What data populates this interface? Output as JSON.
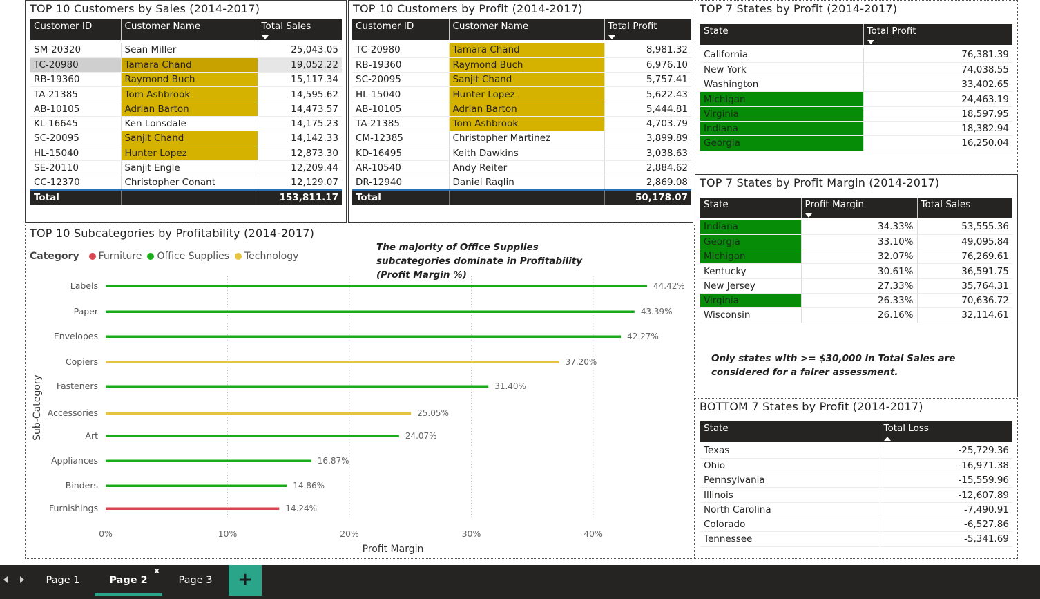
{
  "customers_sales": {
    "title": "TOP 10 Customers by Sales (2014-2017)",
    "headers": [
      "Customer ID",
      "Customer Name",
      "Total Sales"
    ],
    "rows": [
      [
        "SM-20320",
        "Sean Miller",
        "25,043.05"
      ],
      [
        "TC-20980",
        "Tamara Chand",
        "19,052.22"
      ],
      [
        "RB-19360",
        "Raymond Buch",
        "15,117.34"
      ],
      [
        "TA-21385",
        "Tom Ashbrook",
        "14,595.62"
      ],
      [
        "AB-10105",
        "Adrian Barton",
        "14,473.57"
      ],
      [
        "KL-16645",
        "Ken Lonsdale",
        "14,175.23"
      ],
      [
        "SC-20095",
        "Sanjit Chand",
        "14,142.33"
      ],
      [
        "HL-15040",
        "Hunter Lopez",
        "12,873.30"
      ],
      [
        "SE-20110",
        "Sanjit Engle",
        "12,209.44"
      ],
      [
        "CC-12370",
        "Christopher Conant",
        "12,129.07"
      ]
    ],
    "total_label": "Total",
    "total_value": "153,811.17"
  },
  "customers_profit": {
    "title": "TOP 10 Customers by Profit (2014-2017)",
    "headers": [
      "Customer ID",
      "Customer Name",
      "Total Profit"
    ],
    "rows": [
      [
        "TC-20980",
        "Tamara Chand",
        "8,981.32"
      ],
      [
        "RB-19360",
        "Raymond Buch",
        "6,976.10"
      ],
      [
        "SC-20095",
        "Sanjit Chand",
        "5,757.41"
      ],
      [
        "HL-15040",
        "Hunter Lopez",
        "5,622.43"
      ],
      [
        "AB-10105",
        "Adrian Barton",
        "5,444.81"
      ],
      [
        "TA-21385",
        "Tom Ashbrook",
        "4,703.79"
      ],
      [
        "CM-12385",
        "Christopher Martinez",
        "3,899.89"
      ],
      [
        "KD-16495",
        "Keith Dawkins",
        "3,038.63"
      ],
      [
        "AR-10540",
        "Andy Reiter",
        "2,884.62"
      ],
      [
        "DR-12940",
        "Daniel Raglin",
        "2,869.08"
      ]
    ],
    "total_label": "Total",
    "total_value": "50,178.07"
  },
  "states_profit": {
    "title": "TOP 7 States by Profit (2014-2017)",
    "headers": [
      "State",
      "Total Profit"
    ],
    "rows": [
      [
        "California",
        "76,381.39"
      ],
      [
        "New York",
        "74,038.55"
      ],
      [
        "Washington",
        "33,402.65"
      ],
      [
        "Michigan",
        "24,463.19"
      ],
      [
        "Virginia",
        "18,597.95"
      ],
      [
        "Indiana",
        "18,382.94"
      ],
      [
        "Georgia",
        "16,250.04"
      ]
    ]
  },
  "states_margin": {
    "title": "TOP 7 States by Profit Margin (2014-2017)",
    "headers": [
      "State",
      "Profit Margin",
      "Total Sales"
    ],
    "rows": [
      [
        "Indiana",
        "34.33%",
        "53,555.36"
      ],
      [
        "Georgia",
        "33.10%",
        "49,095.84"
      ],
      [
        "Michigan",
        "32.07%",
        "76,269.61"
      ],
      [
        "Kentucky",
        "30.61%",
        "36,591.75"
      ],
      [
        "New Jersey",
        "27.33%",
        "35,764.31"
      ],
      [
        "Virginia",
        "26.33%",
        "70,636.72"
      ],
      [
        "Wisconsin",
        "26.16%",
        "32,114.61"
      ]
    ],
    "note": "Only states with >= $30,000 in Total Sales are considered for a fairer assessment."
  },
  "states_bottom": {
    "title": "BOTTOM 7 States by Profit (2014-2017)",
    "headers": [
      "State",
      "Total Loss"
    ],
    "rows": [
      [
        "Texas",
        "-25,729.36"
      ],
      [
        "Ohio",
        "-16,971.38"
      ],
      [
        "Pennsylvania",
        "-15,559.96"
      ],
      [
        "Illinois",
        "-12,607.89"
      ],
      [
        "North Carolina",
        "-7,490.91"
      ],
      [
        "Colorado",
        "-6,527.86"
      ],
      [
        "Tennessee",
        "-5,341.69"
      ]
    ]
  },
  "subcat": {
    "title": "TOP 10 Subcategories by Profitability (2014-2017)",
    "legend_title": "Category",
    "note": "The majority of Office Supplies subcategories dominate in Profitability (Profit Margin %)"
  },
  "colors": {
    "furniture": "#d64550",
    "office_supplies": "#1aab1a",
    "technology": "#e6c440",
    "highlight_gold": "#d6b200",
    "highlight_green": "#078c07",
    "tab_accent": "#2aa58a"
  },
  "chart_data": {
    "type": "bar",
    "orientation": "horizontal",
    "categories": [
      "Labels",
      "Paper",
      "Envelopes",
      "Copiers",
      "Fasteners",
      "Accessories",
      "Art",
      "Appliances",
      "Binders",
      "Furnishings"
    ],
    "values": [
      44.42,
      43.39,
      42.27,
      37.2,
      31.4,
      25.05,
      24.07,
      16.87,
      14.86,
      14.24
    ],
    "value_labels": [
      "44.42%",
      "43.39%",
      "42.27%",
      "37.20%",
      "31.40%",
      "25.05%",
      "24.07%",
      "16.87%",
      "14.86%",
      "14.24%"
    ],
    "bar_category": [
      "Office Supplies",
      "Office Supplies",
      "Office Supplies",
      "Technology",
      "Office Supplies",
      "Technology",
      "Office Supplies",
      "Office Supplies",
      "Office Supplies",
      "Furniture"
    ],
    "series_names": [
      "Furniture",
      "Office Supplies",
      "Technology"
    ],
    "xlabel": "Profit Margin",
    "ylabel": "Sub-Category",
    "xticks": [
      "0%",
      "10%",
      "20%",
      "30%",
      "40%"
    ],
    "xlim": [
      0,
      50
    ],
    "grid": "vertical dotted",
    "legend": "top-left"
  },
  "tabs": {
    "pages": [
      "Page 1",
      "Page 2",
      "Page 3"
    ],
    "active": "Page 2",
    "close_glyph": "x",
    "add_glyph": "+"
  }
}
